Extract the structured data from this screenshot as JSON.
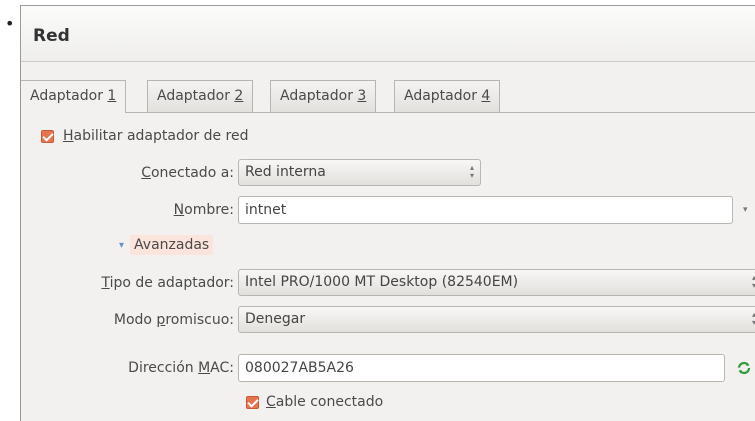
{
  "bullet": "•",
  "dialog": {
    "title": "Red"
  },
  "tabs": [
    {
      "pre": "Adaptador ",
      "key": "1",
      "active": true
    },
    {
      "pre": "Adaptador ",
      "key": "2",
      "active": false
    },
    {
      "pre": "Adaptador ",
      "key": "3",
      "active": false
    },
    {
      "pre": "Adaptador ",
      "key": "4",
      "active": false
    }
  ],
  "enable_adapter": {
    "key": "H",
    "rest": "abilitar adaptador de red",
    "checked": true
  },
  "attached_to": {
    "label_key": "C",
    "label_rest": "onectado a:",
    "value": "Red interna"
  },
  "name": {
    "label_key": "N",
    "label_rest": "ombre:",
    "value": "intnet"
  },
  "advanced": {
    "label": "Avanzadas",
    "expanded": true
  },
  "adapter_type": {
    "label_key": "T",
    "label_rest": "ipo de adaptador:",
    "value": "Intel PRO/1000 MT Desktop (82540EM)"
  },
  "promiscuous": {
    "label_pre": "Modo ",
    "label_key": "p",
    "label_rest": "romiscuo:",
    "value": "Denegar"
  },
  "mac": {
    "label_pre": "Dirección ",
    "label_key": "M",
    "label_rest": "AC:",
    "value": "080027AB5A26"
  },
  "cable": {
    "key": "C",
    "rest": "able conectado",
    "checked": true
  },
  "colors": {
    "accent": "#e8734f",
    "highlight": "#fbe4dc",
    "panel": "#f2f1f0"
  }
}
